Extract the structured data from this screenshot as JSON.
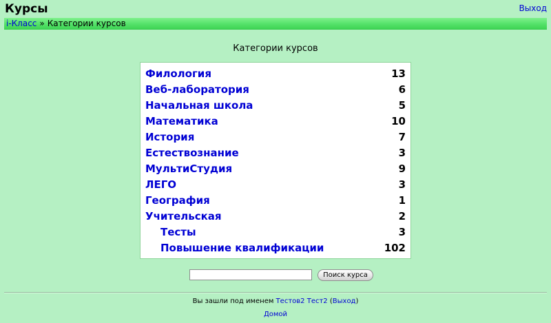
{
  "header": {
    "title": "Курсы",
    "logout_label": "Выход"
  },
  "breadcrumb": {
    "home_label": "i-Класс",
    "separator": "»",
    "current_label": "Категории курсов"
  },
  "main": {
    "section_title": "Категории курсов",
    "categories": [
      {
        "name": "Филология",
        "count": "13"
      },
      {
        "name": "Веб-лаборатория",
        "count": "6"
      },
      {
        "name": "Начальная школа",
        "count": "5"
      },
      {
        "name": "Математика",
        "count": "10"
      },
      {
        "name": "История",
        "count": "7"
      },
      {
        "name": "Естествознание",
        "count": "3"
      },
      {
        "name": "МультиСтудия",
        "count": "9"
      },
      {
        "name": "ЛЕГО",
        "count": "3"
      },
      {
        "name": "География",
        "count": "1"
      },
      {
        "name": "Учительская",
        "count": "2"
      },
      {
        "name": "Тесты",
        "count": "3"
      },
      {
        "name": "Повышение квалификации",
        "count": "102"
      }
    ]
  },
  "search": {
    "value": "",
    "button_label": "Поиск курса"
  },
  "footer": {
    "logged_in_prefix": "Вы зашли под именем",
    "user_name": "Тестов2 Тест2",
    "logout_open": "(",
    "logout_label": "Выход",
    "logout_close": ")",
    "home_label": "Домой"
  },
  "colors": {
    "background": "#b5f0c3",
    "navbar": "#55e26a",
    "link": "#0000d4"
  }
}
